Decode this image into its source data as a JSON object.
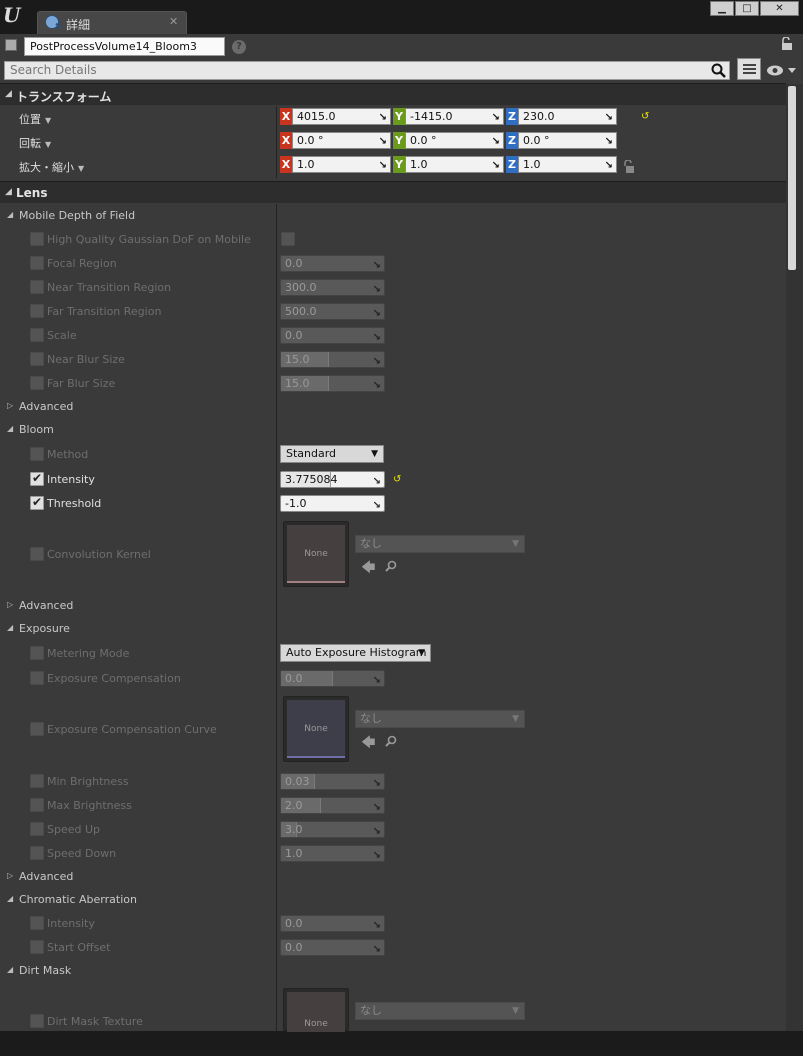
{
  "tab": {
    "title": "詳細",
    "close": "✕"
  },
  "window_buttons": {
    "minimize": "▁",
    "maximize": "□",
    "close": "✕"
  },
  "object_name": "PostProcessVolume14_Bloom3",
  "help": "?",
  "search": {
    "placeholder": "Search Details"
  },
  "transform": {
    "label": "トランスフォーム",
    "rows": [
      {
        "label": "位置",
        "x": "4015.0",
        "y": "-1415.0",
        "z": "230.0"
      },
      {
        "label": "回転",
        "x": "0.0 °",
        "y": "0.0 °",
        "z": "0.0 °"
      },
      {
        "label": "拡大・縮小",
        "x": "1.0",
        "y": "1.0",
        "z": "1.0"
      }
    ],
    "axis": {
      "x": "X",
      "y": "Y",
      "z": "Z"
    }
  },
  "lens": {
    "label": "Lens"
  },
  "mobile_dof": {
    "label": "Mobile Depth of Field",
    "hq": "High Quality Gaussian DoF on Mobile",
    "focal_region": {
      "label": "Focal Region",
      "value": "0.0"
    },
    "near_transition": {
      "label": "Near Transition Region",
      "value": "300.0"
    },
    "far_transition": {
      "label": "Far Transition Region",
      "value": "500.0"
    },
    "scale": {
      "label": "Scale",
      "value": "0.0"
    },
    "near_blur": {
      "label": "Near Blur Size",
      "value": "15.0"
    },
    "far_blur": {
      "label": "Far Blur Size",
      "value": "15.0"
    },
    "advanced": "Advanced"
  },
  "bloom": {
    "label": "Bloom",
    "method": {
      "label": "Method",
      "value": "Standard"
    },
    "intensity": {
      "label": "Intensity",
      "value": "3.775084"
    },
    "threshold": {
      "label": "Threshold",
      "value": "-1.0"
    },
    "kernel": {
      "label": "Convolution Kernel",
      "thumb": "None",
      "asset": "なし"
    },
    "advanced": "Advanced"
  },
  "exposure": {
    "label": "Exposure",
    "metering": {
      "label": "Metering Mode",
      "value": "Auto Exposure Histogram"
    },
    "compensation": {
      "label": "Exposure Compensation",
      "value": "0.0"
    },
    "curve": {
      "label": "Exposure Compensation Curve",
      "thumb": "None",
      "asset": "なし"
    },
    "min_brightness": {
      "label": "Min Brightness",
      "value": "0.03"
    },
    "max_brightness": {
      "label": "Max Brightness",
      "value": "2.0"
    },
    "speed_up": {
      "label": "Speed Up",
      "value": "3.0"
    },
    "speed_down": {
      "label": "Speed Down",
      "value": "1.0"
    },
    "advanced": "Advanced"
  },
  "chromatic": {
    "label": "Chromatic Aberration",
    "intensity": {
      "label": "Intensity",
      "value": "0.0"
    },
    "start_offset": {
      "label": "Start Offset",
      "value": "0.0"
    }
  },
  "dirt": {
    "label": "Dirt Mask",
    "texture": {
      "label": "Dirt Mask Texture",
      "thumb": "None",
      "asset": "なし"
    }
  },
  "colors": {
    "x_axis": "#c8351f",
    "y_axis": "#6b9b1d",
    "z_axis": "#2e6fc4",
    "reset_arrow": "#e8e800"
  }
}
